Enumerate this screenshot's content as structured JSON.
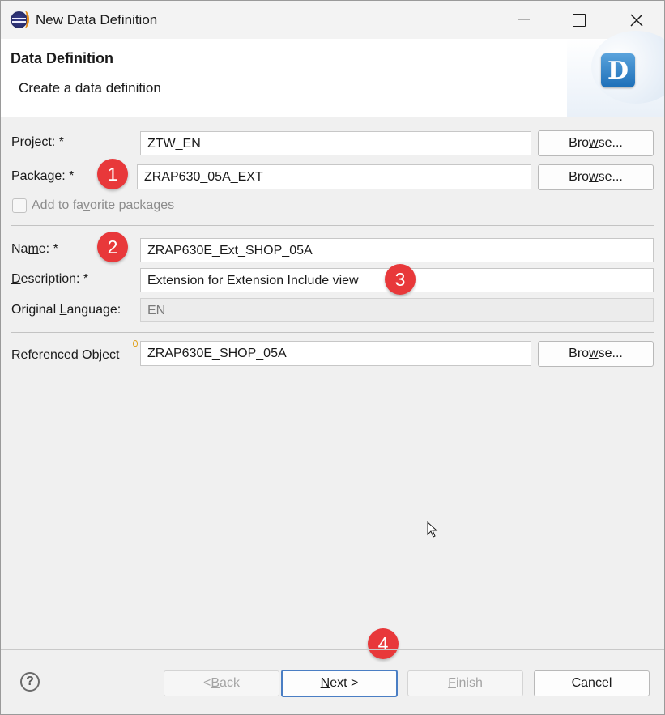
{
  "window": {
    "title": "New Data Definition",
    "icon": "eclipse-icon",
    "controls": [
      "minimize-icon",
      "maximize-icon",
      "close-icon"
    ]
  },
  "header": {
    "title": "Data Definition",
    "subtitle": "Create a data definition",
    "icon_letter": "D"
  },
  "form": {
    "project": {
      "label_pre": "",
      "label_mn": "P",
      "label_post": "roject: *",
      "value": "ZTW_EN"
    },
    "package": {
      "label_pre": "Pac",
      "label_mn": "k",
      "label_post": "age: *",
      "value": "ZRAP630_05A_EXT"
    },
    "favorite": {
      "label_pre": "Add to fa",
      "label_mn": "v",
      "label_post": "orite packages",
      "checked": false,
      "enabled": false
    },
    "name": {
      "label_pre": "Na",
      "label_mn": "m",
      "label_post": "e: *",
      "value": "ZRAP630E_Ext_SHOP_05A"
    },
    "description": {
      "label_pre": "",
      "label_mn": "D",
      "label_post": "escription: *",
      "value": "Extension for Extension Include view"
    },
    "language": {
      "label_pre": "Original ",
      "label_mn": "L",
      "label_post": "anguage:",
      "value": "EN"
    },
    "referenced": {
      "label": "Referenced Object",
      "value": "ZRAP630E_SHOP_05A"
    },
    "browse": {
      "pre": "Bro",
      "mn": "w",
      "post": "se..."
    }
  },
  "badges": [
    "1",
    "2",
    "3",
    "4"
  ],
  "footer": {
    "help": "?",
    "back": {
      "pre": "< ",
      "mn": "B",
      "post": "ack"
    },
    "next": {
      "pre": "",
      "mn": "N",
      "post": "ext >"
    },
    "finish": {
      "pre": "",
      "mn": "F",
      "post": "inish"
    },
    "cancel": "Cancel"
  },
  "colors": {
    "badge": "#e8383a",
    "default_button_border": "#4a7ec4",
    "banner_icon": "#1d6fb8"
  }
}
